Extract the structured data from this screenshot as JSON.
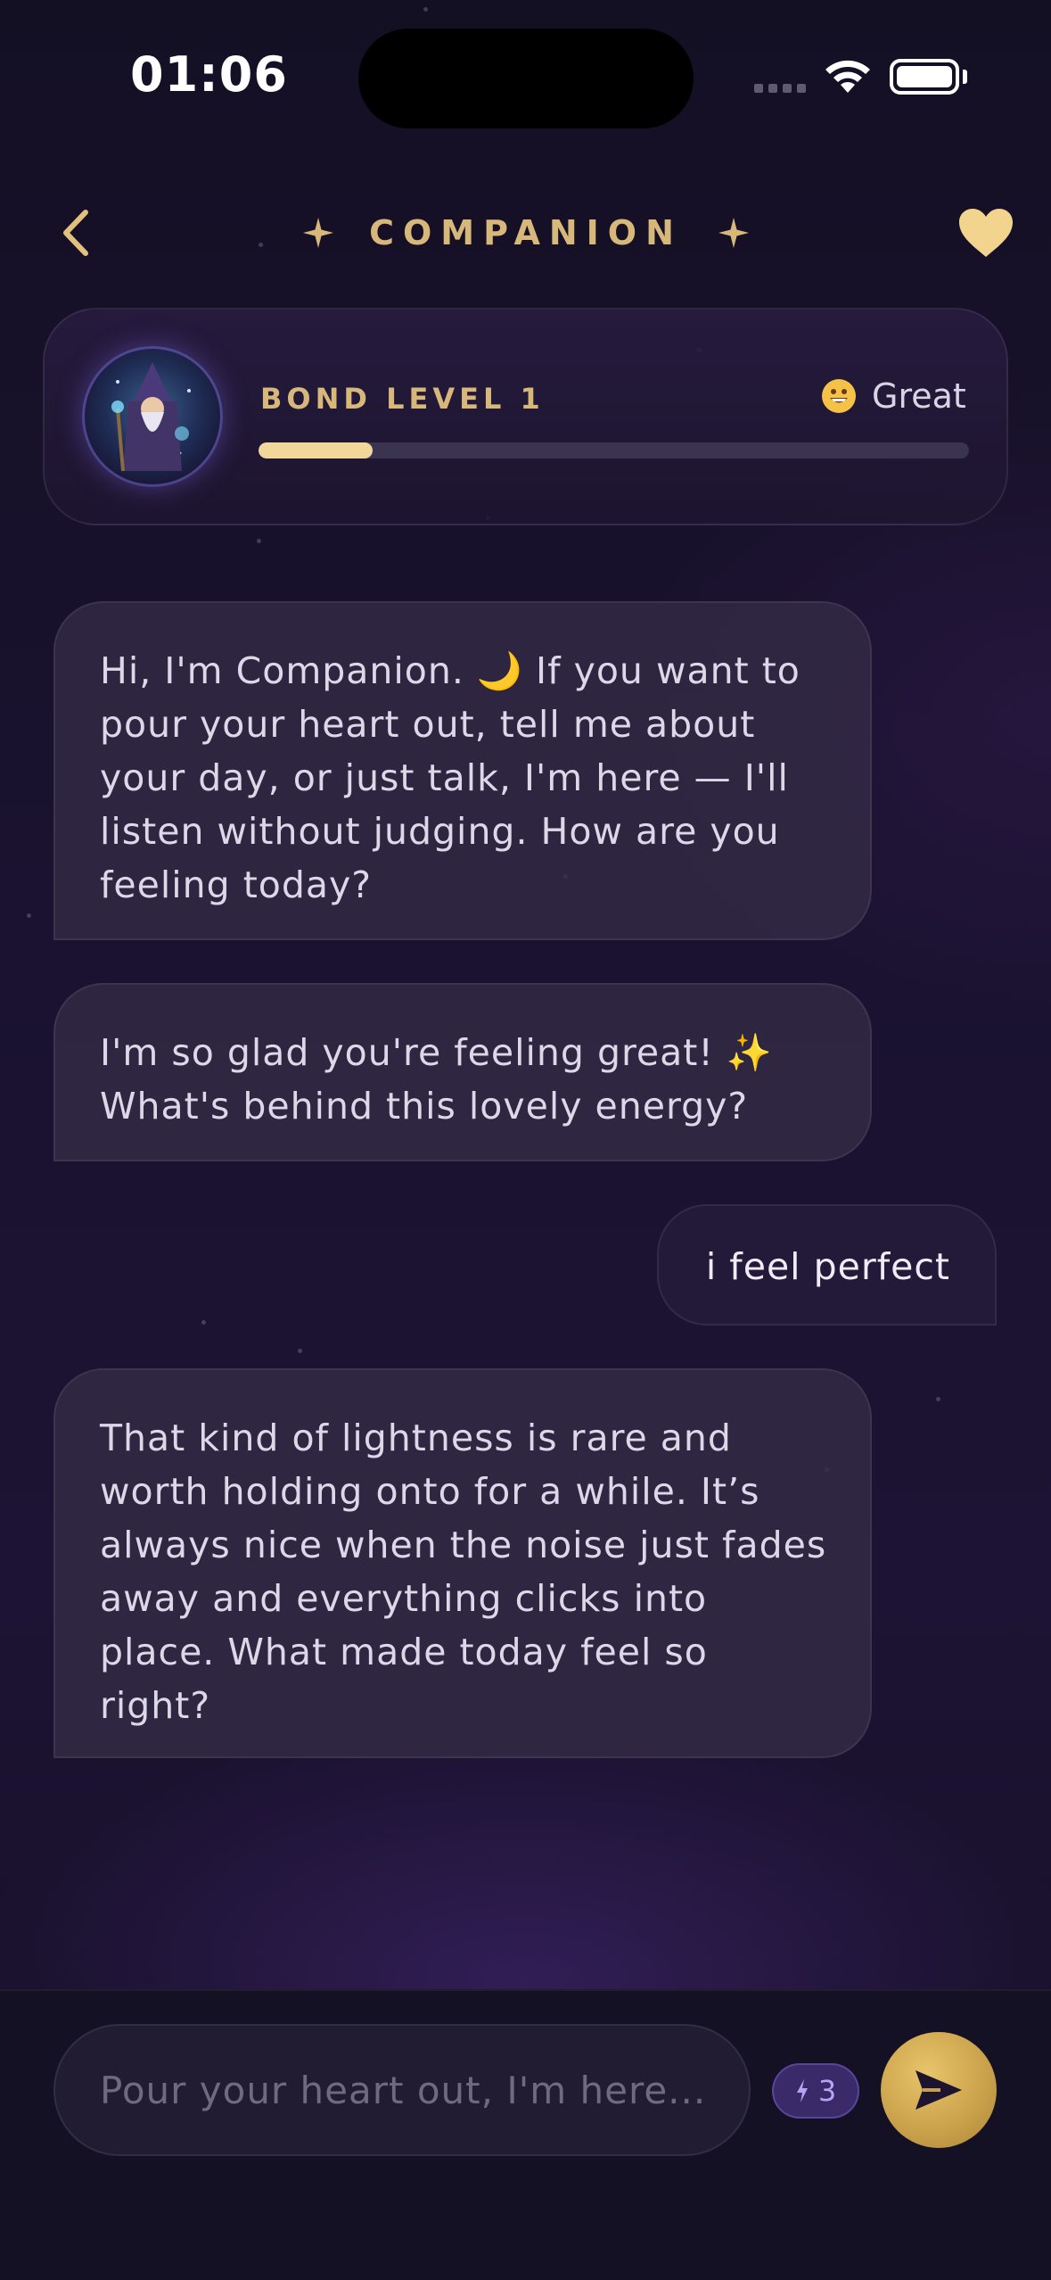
{
  "status_bar": {
    "time": "01:06"
  },
  "header": {
    "title": "COMPANION"
  },
  "bond": {
    "level_label": "BOND LEVEL 1",
    "mood_label": "Great",
    "progress": 0.16
  },
  "messages": [
    {
      "role": "companion",
      "text": "Hi, I'm Companion. 🌙  If you want to pour your heart out, tell me about your day, or just talk, I'm here — I'll listen without judging. How are you feeling today?"
    },
    {
      "role": "companion",
      "text": "I'm so glad you're feeling great! ✨ What's behind this lovely energy?"
    },
    {
      "role": "user",
      "text": "i feel perfect"
    },
    {
      "role": "companion",
      "text": "That kind of lightness is rare and worth holding onto for a while. It’s always nice when the noise just fades away and everything clicks into place. What made today feel so right?"
    }
  ],
  "composer": {
    "placeholder": "Pour your heart out, I'm here...",
    "value": "",
    "energy_count": "3"
  },
  "colors": {
    "accent_gold": "#d8b87a",
    "bond_fill": "#f2d79a",
    "energy_purple": "#b9a3f5"
  }
}
